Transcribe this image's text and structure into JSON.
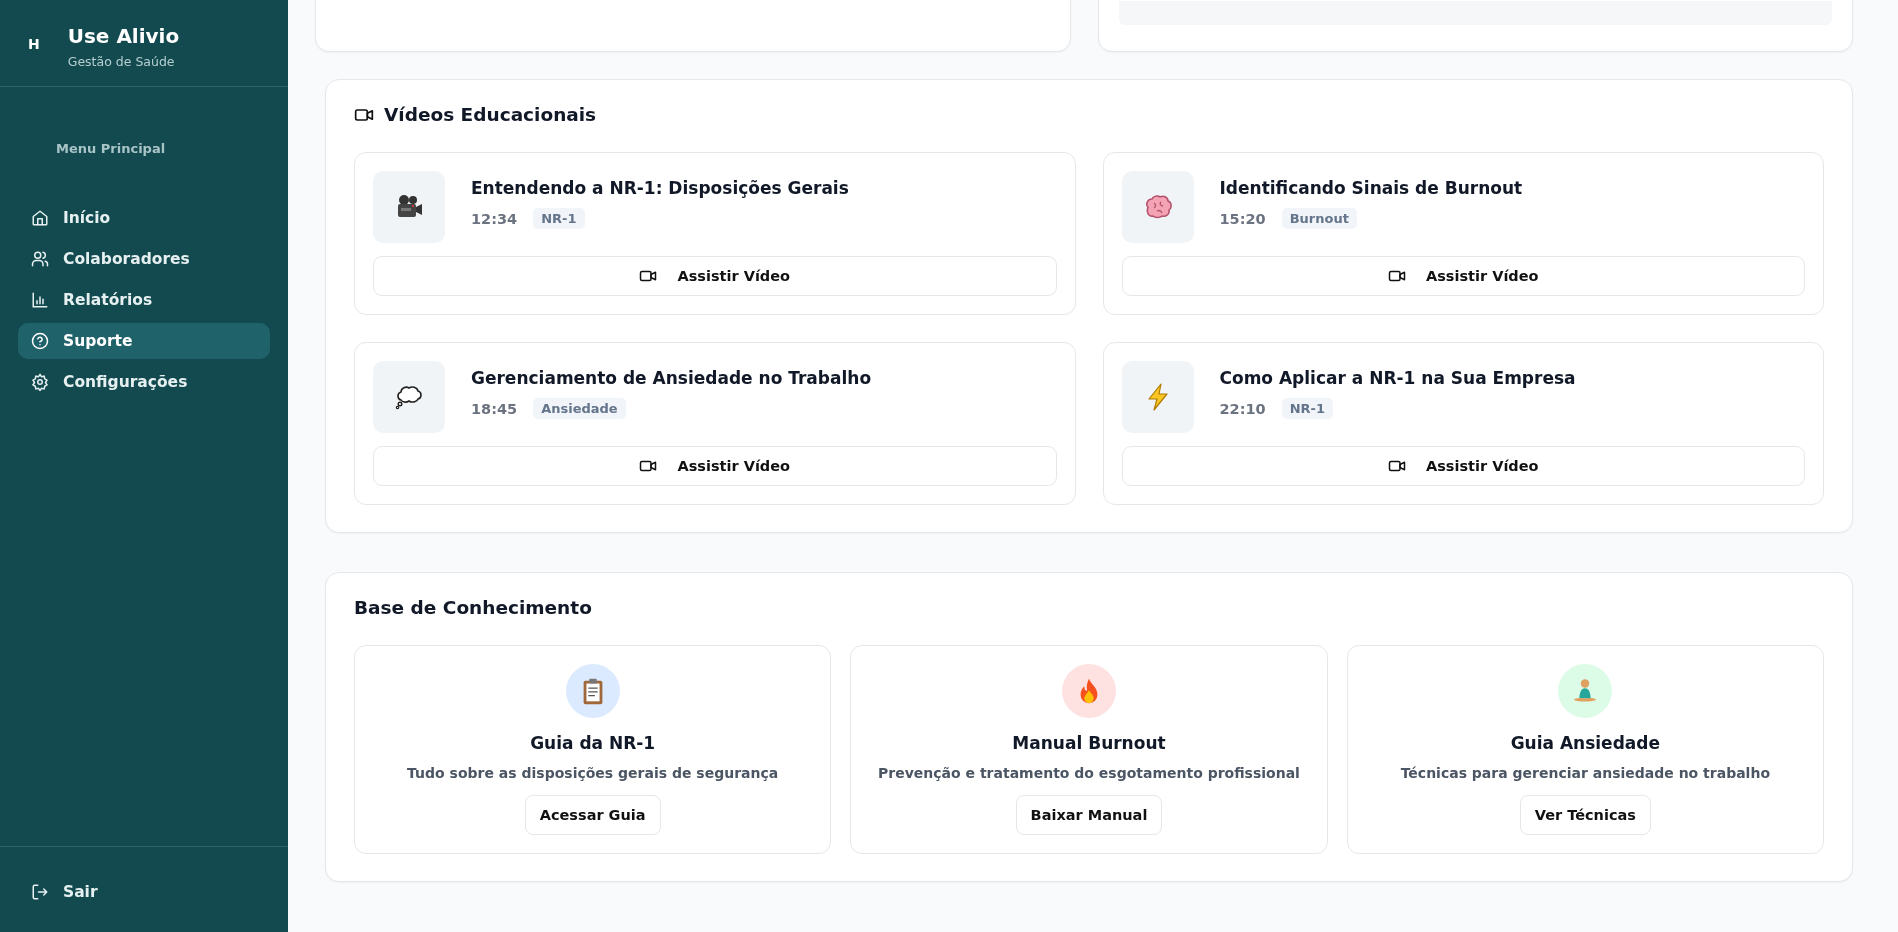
{
  "sidebar": {
    "logo_mark": "H",
    "app_name": "Use Alivio",
    "app_subtitle": "Gestão de Saúde",
    "section_label": "Menu Principal",
    "items": [
      {
        "label": "Início",
        "selected": false
      },
      {
        "label": "Colaboradores",
        "selected": false
      },
      {
        "label": "Relatórios",
        "selected": false
      },
      {
        "label": "Suporte",
        "selected": true
      },
      {
        "label": "Configurações",
        "selected": false
      }
    ],
    "logout": "Sair"
  },
  "videos": {
    "title": "Vídeos Educacionais",
    "items": [
      {
        "title": "Entendendo a NR-1: Disposições Gerais",
        "duration": "12:34",
        "tag": "NR-1",
        "button": "Assistir Vídeo"
      },
      {
        "title": "Identificando Sinais de Burnout",
        "duration": "15:20",
        "tag": "Burnout",
        "button": "Assistir Vídeo"
      },
      {
        "title": "Gerenciamento de Ansiedade no Trabalho",
        "duration": "18:45",
        "tag": "Ansiedade",
        "button": "Assistir Vídeo"
      },
      {
        "title": "Como Aplicar a NR-1 na Sua Empresa",
        "duration": "22:10",
        "tag": "NR-1",
        "button": "Assistir Vídeo"
      }
    ]
  },
  "knowledge_base": {
    "title": "Base de Conhecimento",
    "items": [
      {
        "title": "Guia da NR-1",
        "description": "Tudo sobre as disposições gerais de segurança",
        "button": "Acessar Guia",
        "color": "#dbeafe"
      },
      {
        "title": "Manual Burnout",
        "description": "Prevenção e tratamento do esgotamento profissional",
        "button": "Baixar Manual",
        "color": "#fee2e2"
      },
      {
        "title": "Guia Ansiedade",
        "description": "Técnicas para gerenciar ansiedade no trabalho",
        "button": "Ver Técnicas",
        "color": "#dcfce7"
      }
    ]
  }
}
